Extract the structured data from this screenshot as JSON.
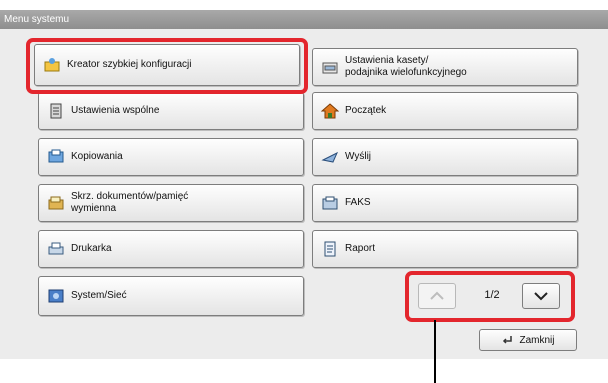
{
  "window": {
    "title": "Menu systemu"
  },
  "menu_items": [
    {
      "label": "Kreator szybkiej konfiguracji",
      "icon": "wizard-icon"
    },
    {
      "label": "Ustawienia kasety/\npodajnika wielofunkcyjnego",
      "icon": "paper-tray-icon"
    },
    {
      "label": "Ustawienia wspólne",
      "icon": "common-settings-icon"
    },
    {
      "label": "Początek",
      "icon": "home-icon"
    },
    {
      "label": "Kopiowania",
      "icon": "copy-icon"
    },
    {
      "label": "Wyślij",
      "icon": "send-icon"
    },
    {
      "label": "Skrz. dokumentów/pamięć\nwymienna",
      "icon": "document-box-icon"
    },
    {
      "label": "FAKS",
      "icon": "fax-icon"
    },
    {
      "label": "Drukarka",
      "icon": "printer-icon"
    },
    {
      "label": "Raport",
      "icon": "report-icon"
    },
    {
      "label": "System/Sieć",
      "icon": "system-network-icon"
    }
  ],
  "pagination": {
    "current": 1,
    "total": 2,
    "label": "1/2"
  },
  "close_button": {
    "label": "Zamknij",
    "icon": "return-arrow-icon"
  },
  "colors": {
    "highlight": "#e3262d",
    "titlebar": "#9a9a9a",
    "panel": "#ececec"
  }
}
